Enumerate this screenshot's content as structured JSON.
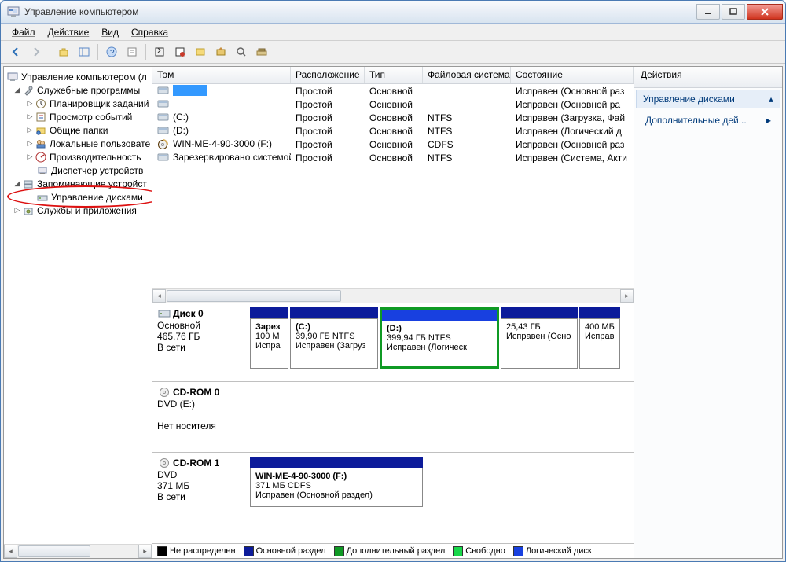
{
  "window": {
    "title": "Управление компьютером"
  },
  "menu": [
    "Файл",
    "Действие",
    "Вид",
    "Справка"
  ],
  "tree": {
    "root": "Управление компьютером (л",
    "n1": "Служебные программы",
    "n1a": "Планировщик заданий",
    "n1b": "Просмотр событий",
    "n1c": "Общие папки",
    "n1d": "Локальные пользовате",
    "n1e": "Производительность",
    "n1f": "Диспетчер устройств",
    "n2": "Запоминающие устройст",
    "n2a": "Управление дисками",
    "n3": "Службы и приложения"
  },
  "vol": {
    "cols": {
      "name": "Том",
      "layout": "Расположение",
      "type": "Тип",
      "fs": "Файловая система",
      "status": "Состояние"
    },
    "rows": [
      {
        "name": "",
        "layout": "Простой",
        "type": "Основной",
        "fs": "",
        "status": "Исправен (Основной раз",
        "ico": "vol",
        "sel": true
      },
      {
        "name": "",
        "layout": "Простой",
        "type": "Основной",
        "fs": "",
        "status": "Исправен (Основной ра",
        "ico": "vol"
      },
      {
        "name": "(C:)",
        "layout": "Простой",
        "type": "Основной",
        "fs": "NTFS",
        "status": "Исправен (Загрузка, Фай",
        "ico": "vol"
      },
      {
        "name": "(D:)",
        "layout": "Простой",
        "type": "Основной",
        "fs": "NTFS",
        "status": "Исправен (Логический д",
        "ico": "vol"
      },
      {
        "name": "WIN-ME-4-90-3000 (F:)",
        "layout": "Простой",
        "type": "Основной",
        "fs": "CDFS",
        "status": "Исправен (Основной раз",
        "ico": "cd"
      },
      {
        "name": "Зарезервировано системой",
        "layout": "Простой",
        "type": "Основной",
        "fs": "NTFS",
        "status": "Исправен (Система, Акти",
        "ico": "vol"
      }
    ]
  },
  "disks": {
    "d0": {
      "name": "Диск 0",
      "type": "Основной",
      "size": "465,76 ГБ",
      "status": "В сети"
    },
    "d0p0": {
      "title": "Зарез",
      "l2": "100 М",
      "l3": "Испра"
    },
    "d0p1": {
      "title": "(C:)",
      "l2": "39,90 ГБ NTFS",
      "l3": "Исправен (Загруз"
    },
    "d0p2": {
      "title": "(D:)",
      "l2": "399,94 ГБ NTFS",
      "l3": "Исправен (Логическ"
    },
    "d0p3": {
      "title": "",
      "l2": "25,43 ГБ",
      "l3": "Исправен (Осно"
    },
    "d0p4": {
      "title": "",
      "l2": "400 МБ",
      "l3": "Исправ"
    },
    "cd0": {
      "name": "CD-ROM 0",
      "type": "DVD (E:)",
      "status": "Нет носителя"
    },
    "cd1": {
      "name": "CD-ROM 1",
      "type": "DVD",
      "size": "371 МБ",
      "status": "В сети"
    },
    "cd1p": {
      "title": "WIN-ME-4-90-3000  (F:)",
      "l2": "371 МБ CDFS",
      "l3": "Исправен (Основной раздел)"
    }
  },
  "legend": {
    "unalloc": "Не распределен",
    "primary": "Основной раздел",
    "extended": "Дополнительный раздел",
    "free": "Свободно",
    "logical": "Логический диск"
  },
  "actions": {
    "title": "Действия",
    "group": "Управление дисками",
    "more": "Дополнительные дей..."
  },
  "colors": {
    "primary": "#0c1b9a",
    "extended": "#0f9a24",
    "free": "#18d84a",
    "logical": "#1840e0",
    "black": "#000"
  }
}
